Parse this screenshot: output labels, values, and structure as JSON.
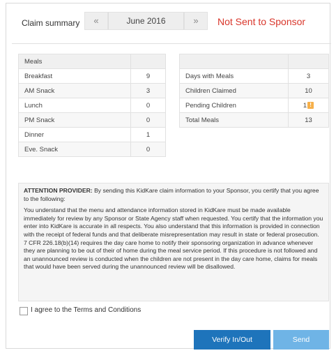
{
  "header": {
    "label": "Claim summary",
    "prev_symbol": "«",
    "month": "June 2016",
    "next_symbol": "»",
    "status": "Not Sent to Sponsor"
  },
  "meals": {
    "header": "Meals",
    "rows": [
      {
        "label": "Breakfast",
        "value": "9"
      },
      {
        "label": "AM Snack",
        "value": "3"
      },
      {
        "label": "Lunch",
        "value": "0"
      },
      {
        "label": "PM Snack",
        "value": "0"
      },
      {
        "label": "Dinner",
        "value": "1"
      },
      {
        "label": "Eve. Snack",
        "value": "0"
      }
    ]
  },
  "stats": {
    "rows": [
      {
        "label": "Days with Meals",
        "value": "3"
      },
      {
        "label": "Children Claimed",
        "value": "10"
      },
      {
        "label": "Pending Children",
        "value": "1",
        "icon": "warning-icon",
        "icon_glyph": "!"
      },
      {
        "label": "Total Meals",
        "value": "13"
      }
    ]
  },
  "attention": {
    "title": "ATTENTION PROVIDER:",
    "lead": "By sending this KidKare claim information to your Sponsor, you certify that you agree to the following:",
    "body": "You understand that the menu and attendance information stored in KidKare must be made available immediately for review by any Sponsor or State Agency staff when requested. You certify that the information you enter into KidKare is accurate in all respects. You also understand that this information is provided in connection with the receipt of federal funds and that deliberate misrepresentation may result in state or federal prosecution. 7 CFR 226.18(b)(14) requires the day care home to notify their sponsoring organization in advance whenever they are planning to be out of their of home during the meal service period. If this procedure is not followed and an unannounced review is conducted when the children are not present in the day care home, claims for meals that would have been served during the unannounced review will be disallowed."
  },
  "agree": {
    "label": "I agree to the Terms and Conditions",
    "checked": false
  },
  "buttons": {
    "verify": "Verify In/Out",
    "send": "Send"
  },
  "colors": {
    "status": "#d9362b",
    "verify_button": "#1e74bb",
    "send_button": "#6fb4e6",
    "warning_icon": "#f6b04a"
  }
}
